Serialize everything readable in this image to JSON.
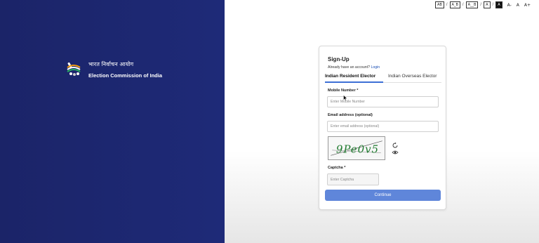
{
  "brand": {
    "hindi_name": "भारत निर्वाचन आयोग",
    "english_name": "Election Commission of India"
  },
  "accessibility_bar": {
    "contrast_options": [
      "AB",
      "A_B",
      "A__B"
    ],
    "theme_light": "A",
    "theme_dark": "A",
    "font_decrease": "A-",
    "font_normal": "A",
    "font_increase": "A+"
  },
  "signup": {
    "title": "Sign-Up",
    "account_prompt": "Already have an account?",
    "login_link": "Login",
    "tabs": [
      "Indian Resident Elector",
      "Indian Overseas Elector"
    ],
    "active_tab": "Indian Resident Elector",
    "mobile_label": "Mobile Number *",
    "mobile_placeholder": "Enter Mobile Number",
    "email_label": "Email address (optional)",
    "email_placeholder": "Enter email address (optional)",
    "captcha_text": "9Pe0v5",
    "captcha_label": "Captcha *",
    "captcha_placeholder": "Enter Captcha",
    "continue_label": "Continue"
  },
  "colors": {
    "left_panel": "#1e2a78",
    "accent": "#3d6fd6",
    "button": "#5f86da",
    "captcha_ink": "#1f7a2e"
  }
}
